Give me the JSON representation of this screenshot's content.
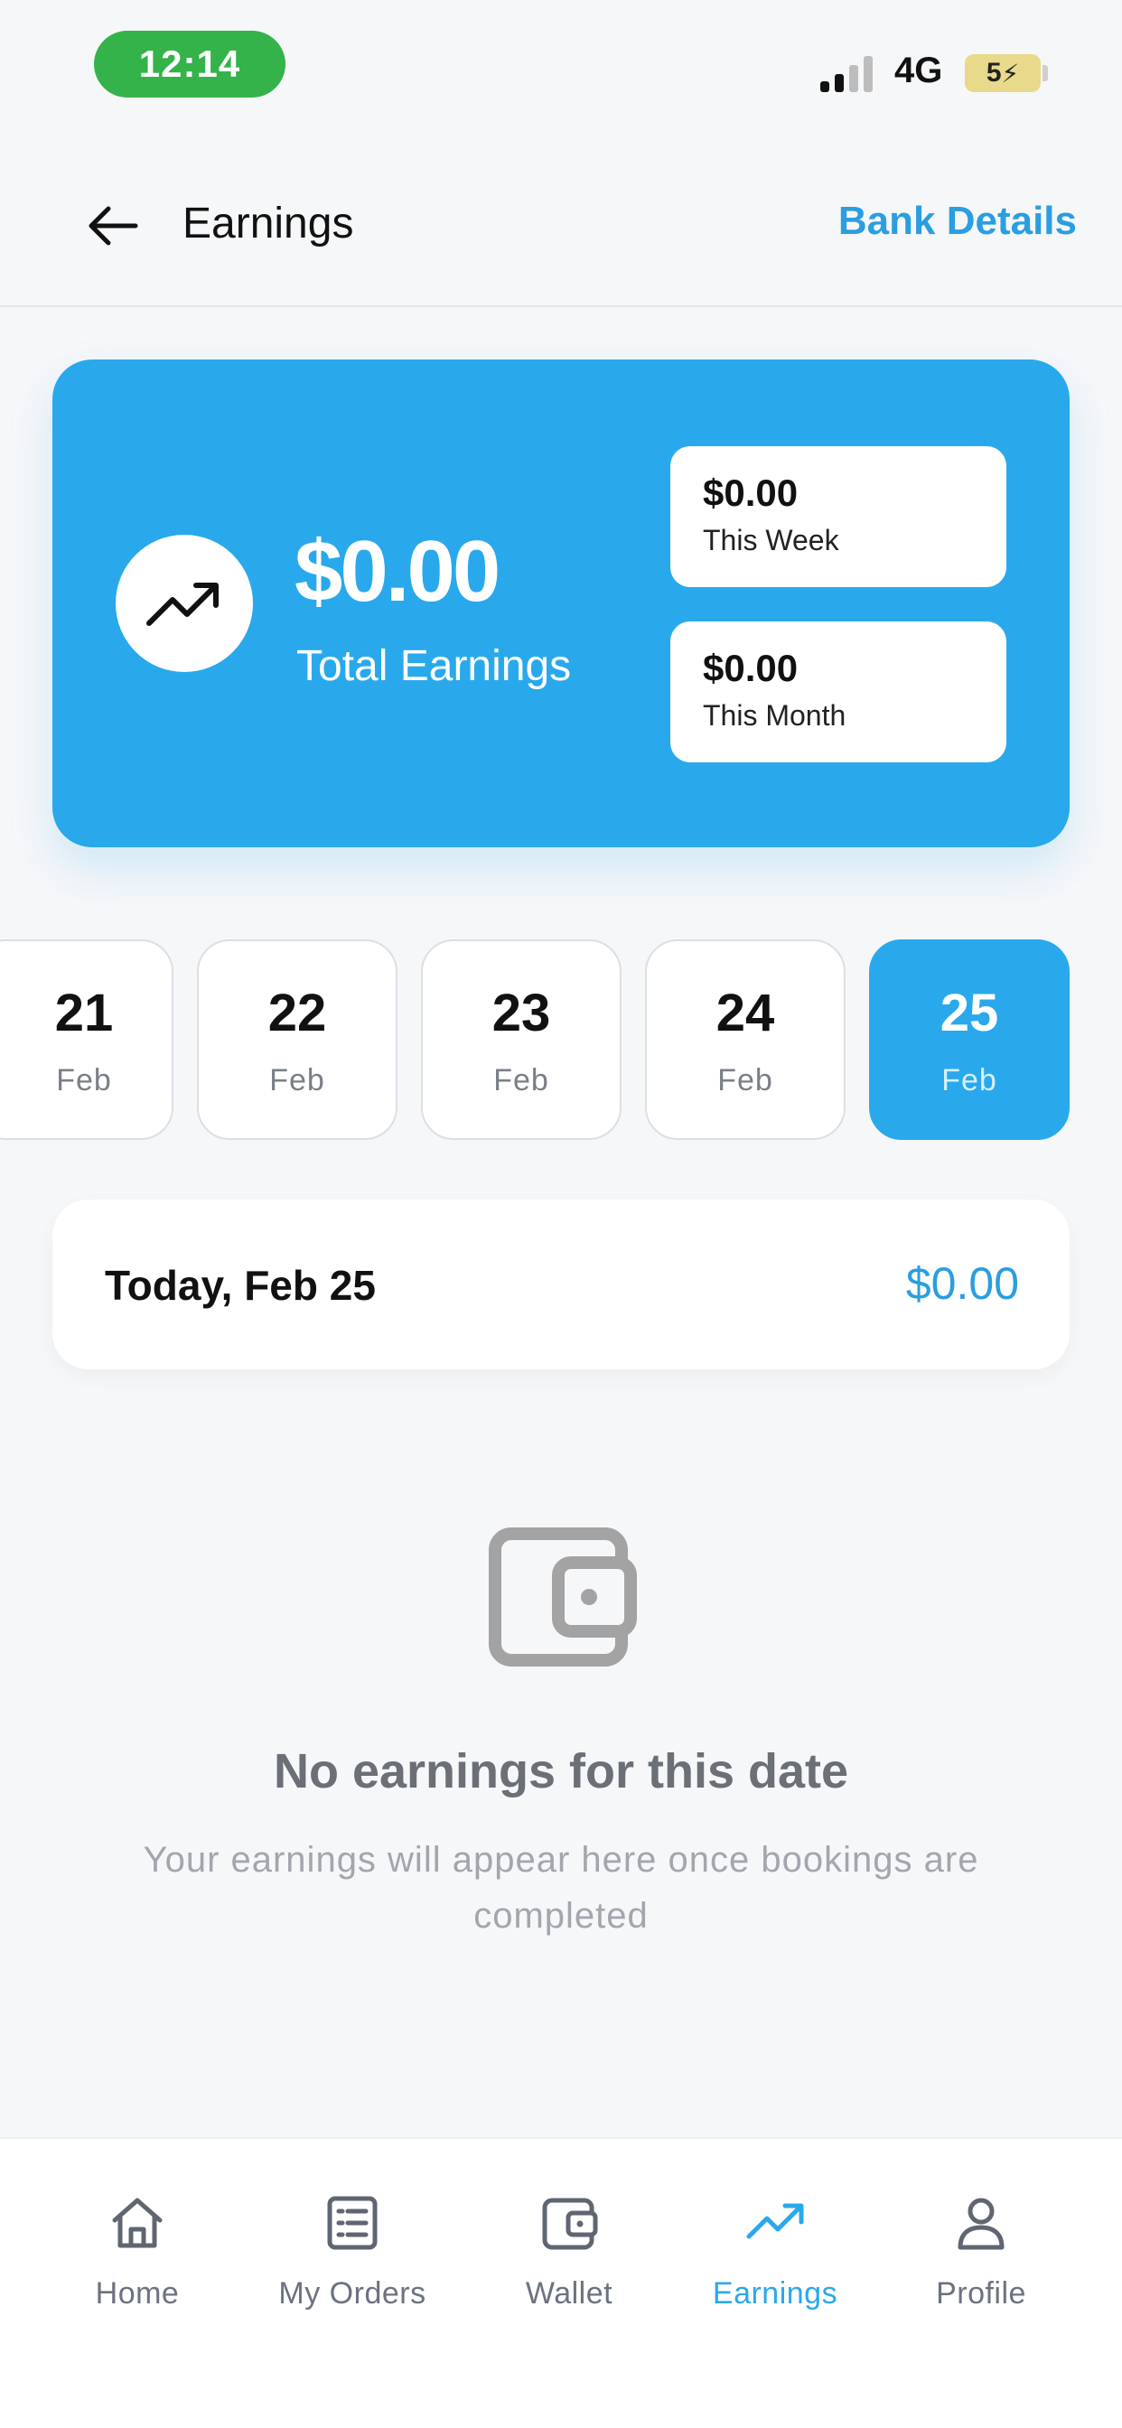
{
  "status_bar": {
    "time": "12:14",
    "network": "4G",
    "battery": "5"
  },
  "header": {
    "title": "Earnings",
    "bank_details_label": "Bank Details"
  },
  "summary": {
    "total_amount": "$0.00",
    "total_label": "Total Earnings",
    "week_amount": "$0.00",
    "week_label": "This Week",
    "month_amount": "$0.00",
    "month_label": "This Month"
  },
  "dates": [
    {
      "day": "21",
      "month": "Feb"
    },
    {
      "day": "22",
      "month": "Feb"
    },
    {
      "day": "23",
      "month": "Feb"
    },
    {
      "day": "24",
      "month": "Feb"
    },
    {
      "day": "25",
      "month": "Feb"
    }
  ],
  "selected_date_index": 4,
  "today": {
    "label": "Today, Feb 25",
    "amount": "$0.00"
  },
  "empty_state": {
    "icon": "wallet-icon",
    "title": "No earnings for this date",
    "description": "Your earnings will appear here once bookings are completed"
  },
  "bottom_nav": [
    {
      "label": "Home",
      "icon": "home-icon"
    },
    {
      "label": "My Orders",
      "icon": "orders-list-icon"
    },
    {
      "label": "Wallet",
      "icon": "wallet-icon"
    },
    {
      "label": "Earnings",
      "icon": "trending-up-icon"
    },
    {
      "label": "Profile",
      "icon": "profile-icon"
    }
  ],
  "active_nav_index": 3,
  "colors": {
    "accent": "#29a9ec",
    "link": "#2a9ee0",
    "status_pill": "#34b34a",
    "inactive_nav": "#6b7280",
    "background": "#f6f7f9"
  }
}
